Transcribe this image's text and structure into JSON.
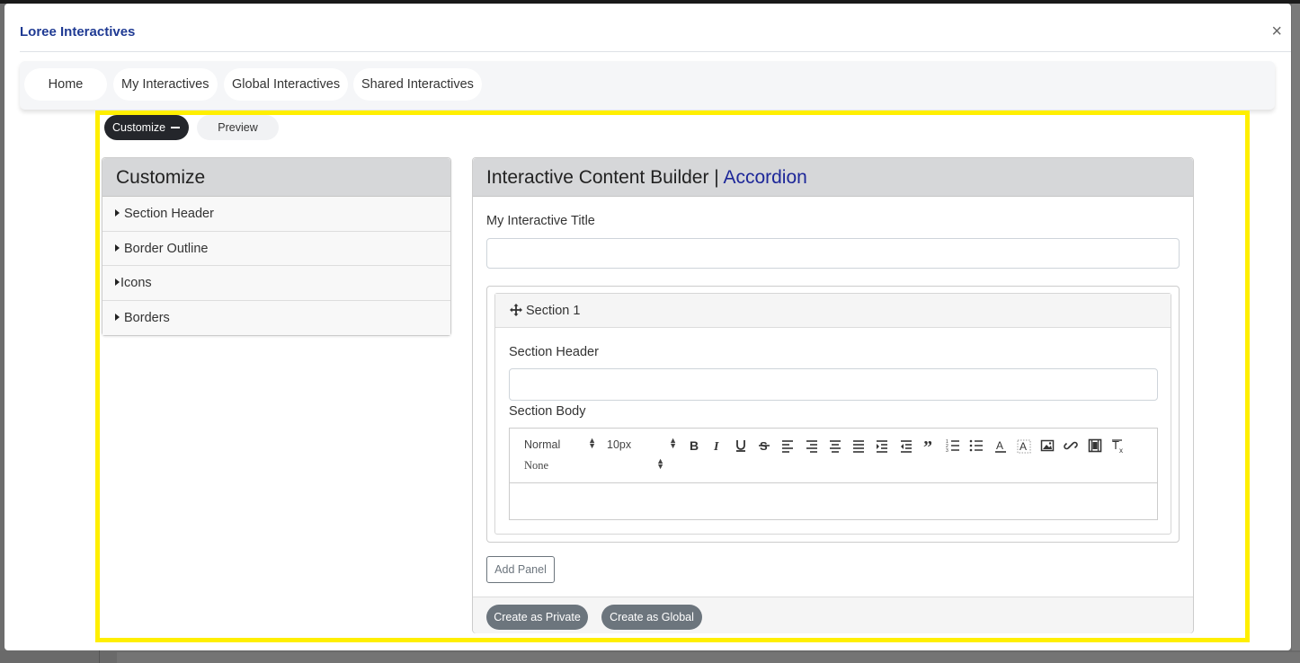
{
  "modal": {
    "title": "Loree Interactives",
    "close": "×"
  },
  "nav": {
    "items": [
      {
        "label": "Home"
      },
      {
        "label": "My Interactives"
      },
      {
        "label": "Global Interactives"
      },
      {
        "label": "Shared Interactives"
      }
    ]
  },
  "view_toggle": {
    "customize_label": "Customize",
    "preview_label": "Preview"
  },
  "customize": {
    "title": "Customize",
    "items": [
      {
        "label": "Section Header"
      },
      {
        "label": "Border Outline"
      },
      {
        "label": "Icons"
      },
      {
        "label": "Borders"
      }
    ]
  },
  "builder": {
    "title": "Interactive Content Builder | ",
    "type": "Accordion",
    "title_label": "My Interactive Title",
    "title_value": "",
    "section": {
      "name": "Section 1",
      "header_label": "Section Header",
      "header_value": "",
      "body_label": "Section Body"
    },
    "toolbar": {
      "format": "Normal",
      "size": "10px",
      "font": "None",
      "buttons": [
        "bold-icon",
        "italic-icon",
        "underline-icon",
        "strikethrough-icon",
        "align-left-icon",
        "align-right-icon",
        "align-center-icon",
        "align-justify-icon",
        "indent-icon",
        "outdent-icon",
        "blockquote-icon",
        "ordered-list-icon",
        "bullet-list-icon",
        "text-color-icon",
        "background-color-icon",
        "image-icon",
        "link-icon",
        "video-icon",
        "clear-format-icon"
      ]
    },
    "add_panel_label": "Add Panel",
    "create_private_label": "Create as Private",
    "create_global_label": "Create as Global"
  },
  "colors": {
    "highlight": "#ffef00",
    "accent": "#1d2799",
    "title": "#1f3a93"
  }
}
